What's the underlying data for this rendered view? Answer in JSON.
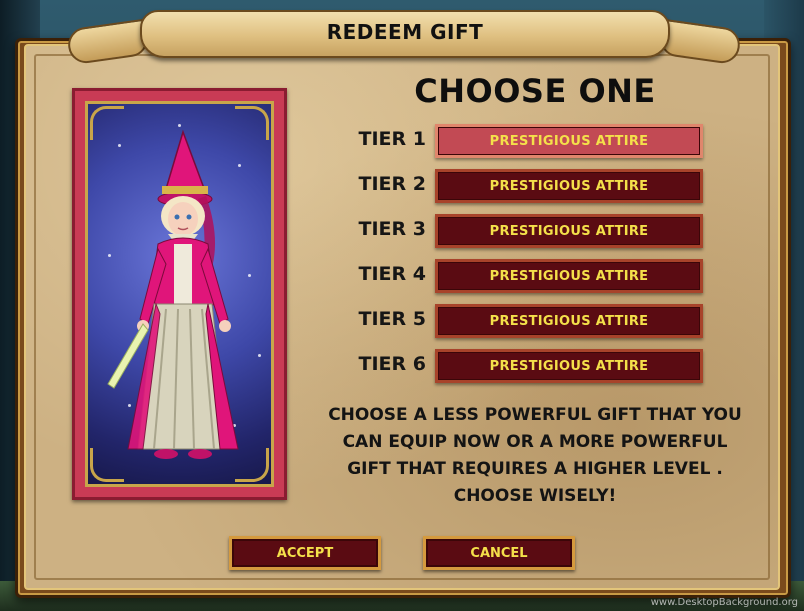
{
  "dialog": {
    "title": "REDEEM GIFT",
    "heading": "CHOOSE ONE",
    "tiers": [
      {
        "label": "TIER 1",
        "option": "PRESTIGIOUS ATTIRE",
        "selected": true
      },
      {
        "label": "TIER 2",
        "option": "PRESTIGIOUS ATTIRE",
        "selected": false
      },
      {
        "label": "TIER 3",
        "option": "PRESTIGIOUS ATTIRE",
        "selected": false
      },
      {
        "label": "TIER 4",
        "option": "PRESTIGIOUS ATTIRE",
        "selected": false
      },
      {
        "label": "TIER 5",
        "option": "PRESTIGIOUS ATTIRE",
        "selected": false
      },
      {
        "label": "TIER 6",
        "option": "PRESTIGIOUS ATTIRE",
        "selected": false
      }
    ],
    "instructions_lines": [
      "CHOOSE A LESS POWERFUL GIFT THAT YOU",
      "CAN EQUIP NOW OR A MORE POWERFUL",
      "GIFT THAT REQUIRES A HIGHER LEVEL .",
      "CHOOSE WISELY!"
    ],
    "accept_label": "ACCEPT",
    "cancel_label": "CANCEL"
  },
  "watermark": "www.DesktopBackground.org",
  "colors": {
    "parchment": "#cdb183",
    "button_dark": "#5a0b12",
    "button_selected": "#c24a54",
    "button_text": "#f4e04a",
    "card_frame": "#c93b55"
  }
}
